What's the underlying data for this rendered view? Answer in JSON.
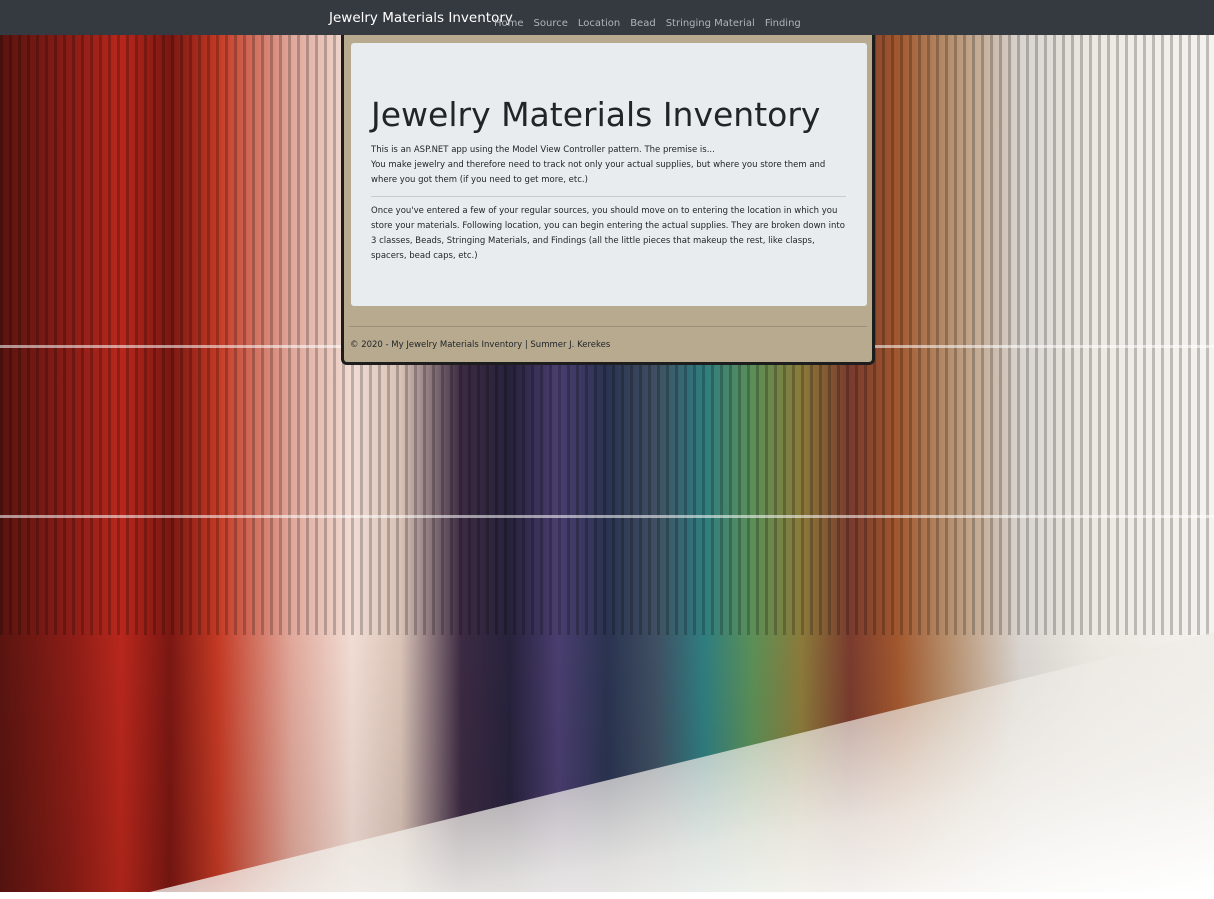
{
  "navbar": {
    "brand": "Jewelry Materials Inventory",
    "links": [
      "Home",
      "Source",
      "Location",
      "Bead",
      "Stringing Material",
      "Finding"
    ]
  },
  "jumbotron": {
    "title": "Jewelry Materials Inventory",
    "intro_line1": "This is an ASP.NET app using the Model View Controller pattern. The premise is...",
    "intro_line2": "You make jewelry and therefore need to track not only your actual supplies, but where you store them and where you got them (if you need to get more, etc.)",
    "body": "Once you've entered a few of your regular sources, you should move on to entering the location in which you store your materials. Following location, you can begin entering the actual supplies. They are broken down into 3 classes, Beads, Stringing Materials, and Findings (all the little pieces that makeup the rest, like clasps, spacers, bead caps, etc.)"
  },
  "footer": {
    "text": "© 2020 - My Jewelry Materials Inventory | Summer J. Kerekes"
  },
  "colors": {
    "navbar": "#343a40",
    "container": "#b7aa8f",
    "jumbotron": "#e9ecef",
    "text": "#212529"
  }
}
